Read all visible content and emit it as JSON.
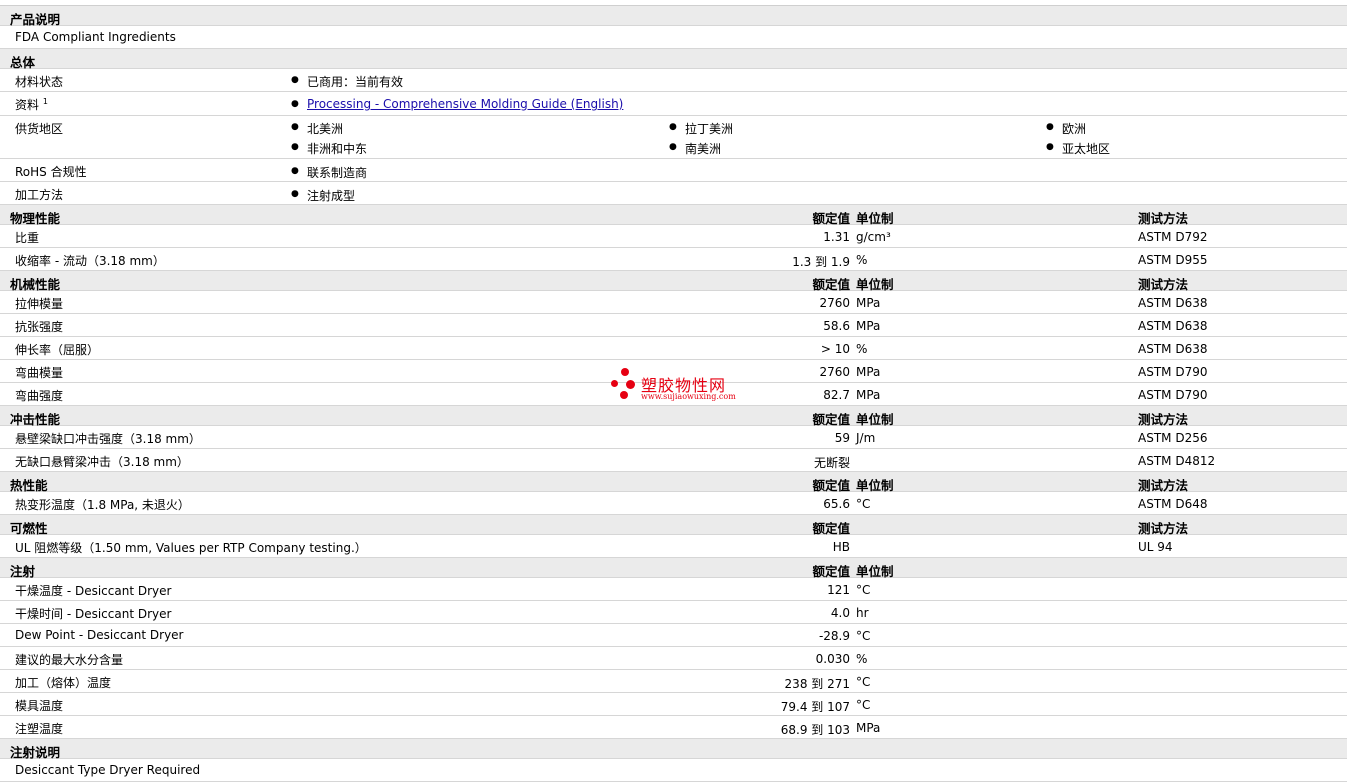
{
  "product": {
    "header": "产品说明",
    "description": "FDA Compliant Ingredients"
  },
  "general": {
    "header": "总体",
    "status_label": "材料状态",
    "status_value": "已商用：当前有效",
    "docs_label": "资料",
    "docs_sup": "1",
    "docs_link": "Processing - Comprehensive Molding Guide (English)",
    "supply_label": "供货地区",
    "regions": [
      "北美洲",
      "拉丁美洲",
      "欧洲",
      "非洲和中东",
      "南美洲",
      "亚太地区"
    ],
    "rohs_label": "RoHS 合规性",
    "rohs_value": "联系制造商",
    "process_label": "加工方法",
    "process_value": "注射成型"
  },
  "columns": {
    "value": "额定值",
    "unit": "单位制",
    "method": "测试方法"
  },
  "physical": {
    "header": "物理性能",
    "rows": [
      {
        "label": "比重",
        "value": "1.31",
        "unit": "g/cm³",
        "method": "ASTM D792"
      },
      {
        "label": "收缩率  - 流动（3.18 mm）",
        "value": "1.3 到  1.9",
        "unit": "%",
        "method": "ASTM D955"
      }
    ]
  },
  "mechanical": {
    "header": "机械性能",
    "rows": [
      {
        "label": "拉伸模量",
        "value": "2760",
        "unit": "MPa",
        "method": "ASTM D638"
      },
      {
        "label": "抗张强度",
        "value": "58.6",
        "unit": "MPa",
        "method": "ASTM D638"
      },
      {
        "label": "伸长率（屈服）",
        "value": "> 10",
        "unit": "%",
        "method": "ASTM D638"
      },
      {
        "label": "弯曲模量",
        "value": "2760",
        "unit": "MPa",
        "method": "ASTM D790"
      },
      {
        "label": "弯曲强度",
        "value": "82.7",
        "unit": "MPa",
        "method": "ASTM D790"
      }
    ]
  },
  "impact": {
    "header": "冲击性能",
    "rows": [
      {
        "label": "悬壁梁缺口冲击强度（3.18 mm）",
        "value": "59",
        "unit": "J/m",
        "method": "ASTM D256"
      },
      {
        "label": "无缺口悬臂梁冲击（3.18 mm）",
        "value": "无断裂",
        "unit": "",
        "method": "ASTM D4812"
      }
    ]
  },
  "thermal": {
    "header": "热性能",
    "rows": [
      {
        "label": "热变形温度（1.8 MPa, 未退火）",
        "value": "65.6",
        "unit": "°C",
        "method": "ASTM D648"
      }
    ]
  },
  "flammability": {
    "header": "可燃性",
    "rows": [
      {
        "label": "UL 阻燃等级（1.50 mm, Values per RTP Company testing.）",
        "value": "HB",
        "unit": "",
        "method": "UL 94"
      }
    ]
  },
  "injection": {
    "header": "注射",
    "rows": [
      {
        "label": "干燥温度  - Desiccant Dryer",
        "value": "121",
        "unit": "°C"
      },
      {
        "label": "干燥时间  - Desiccant Dryer",
        "value": "4.0",
        "unit": "hr"
      },
      {
        "label": "Dew Point - Desiccant Dryer",
        "value": "-28.9",
        "unit": "°C"
      },
      {
        "label": "建议的最大水分含量",
        "value": "0.030",
        "unit": "%"
      },
      {
        "label": "加工（熔体）温度",
        "value": "238 到  271",
        "unit": "°C"
      },
      {
        "label": "模具温度",
        "value": "79.4 到  107",
        "unit": "°C"
      },
      {
        "label": "注塑温度",
        "value": "68.9 到  103",
        "unit": "MPa"
      }
    ]
  },
  "injection_notes": {
    "header": "注射说明",
    "text": "Desiccant Type Dryer Required"
  },
  "watermark": {
    "cn": "塑胶物性网",
    "en": "www.sujiaowuxing.com",
    "color": "#e60012"
  }
}
